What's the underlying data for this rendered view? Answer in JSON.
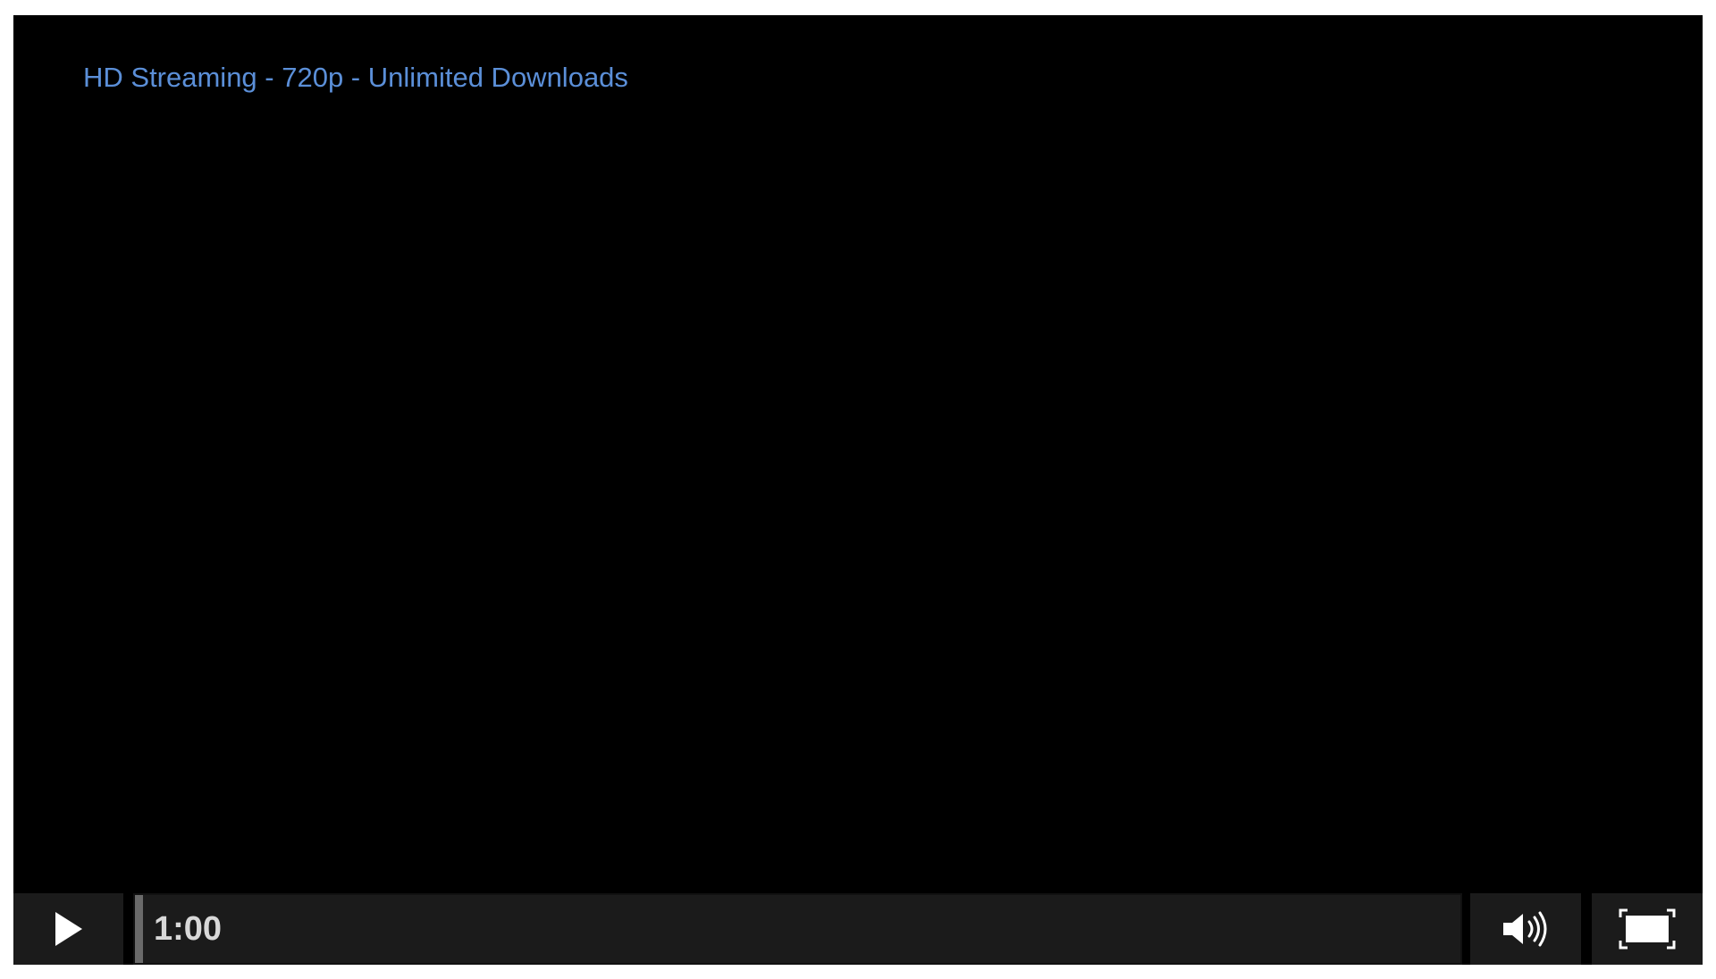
{
  "player": {
    "title_link": "HD Streaming - 720p - Unlimited Downloads",
    "time": "1:00",
    "progress": 0.006,
    "icons": {
      "play": "play-icon",
      "volume": "volume-icon",
      "fullscreen": "fullscreen-icon"
    },
    "colors": {
      "title_link": "#5b8fd8",
      "background": "#000000",
      "controls": "#1b1b1b",
      "icon": "#ffffff",
      "time_text": "#d8d8d8"
    }
  }
}
